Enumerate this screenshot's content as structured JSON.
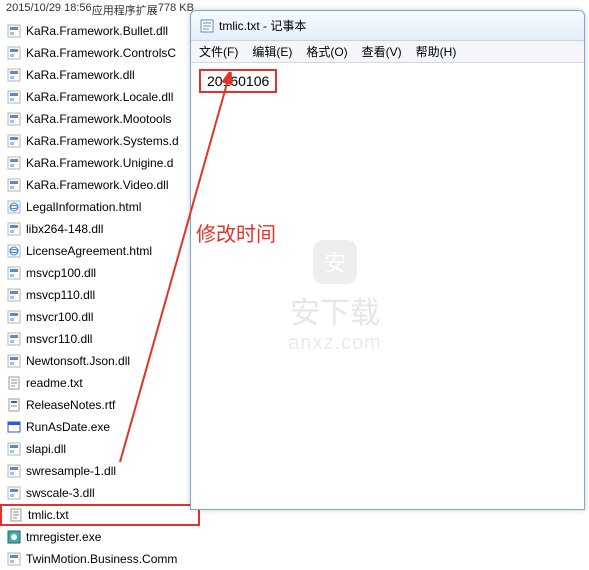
{
  "explorer": {
    "header": {
      "date": "2015/10/29 18:56",
      "type": "应用程序扩展",
      "size": "778 KB"
    },
    "files": [
      {
        "name": "KaRa.Framework.Bullet.dll",
        "icon": "dll"
      },
      {
        "name": "KaRa.Framework.ControlsC",
        "icon": "dll"
      },
      {
        "name": "KaRa.Framework.dll",
        "icon": "dll"
      },
      {
        "name": "KaRa.Framework.Locale.dll",
        "icon": "dll"
      },
      {
        "name": "KaRa.Framework.Mootools",
        "icon": "dll"
      },
      {
        "name": "KaRa.Framework.Systems.d",
        "icon": "dll"
      },
      {
        "name": "KaRa.Framework.Unigine.d",
        "icon": "dll"
      },
      {
        "name": "KaRa.Framework.Video.dll",
        "icon": "dll"
      },
      {
        "name": "LegalInformation.html",
        "icon": "html"
      },
      {
        "name": "libx264-148.dll",
        "icon": "dll"
      },
      {
        "name": "LicenseAgreement.html",
        "icon": "html"
      },
      {
        "name": "msvcp100.dll",
        "icon": "dll"
      },
      {
        "name": "msvcp110.dll",
        "icon": "dll"
      },
      {
        "name": "msvcr100.dll",
        "icon": "dll"
      },
      {
        "name": "msvcr110.dll",
        "icon": "dll"
      },
      {
        "name": "Newtonsoft.Json.dll",
        "icon": "dll"
      },
      {
        "name": "readme.txt",
        "icon": "txt"
      },
      {
        "name": "ReleaseNotes.rtf",
        "icon": "rtf"
      },
      {
        "name": "RunAsDate.exe",
        "icon": "exe"
      },
      {
        "name": "slapi.dll",
        "icon": "dll"
      },
      {
        "name": "swresample-1.dll",
        "icon": "dll"
      },
      {
        "name": "swscale-3.dll",
        "icon": "dll"
      },
      {
        "name": "tmlic.txt",
        "icon": "txt"
      },
      {
        "name": "tmregister.exe",
        "icon": "exe2"
      },
      {
        "name": "TwinMotion.Business.Comm",
        "icon": "dll"
      }
    ],
    "highlighted_index": 22
  },
  "notepad": {
    "title": "tmlic.txt - 记事本",
    "menu": {
      "file": "文件(F)",
      "edit": "编辑(E)",
      "format": "格式(O)",
      "view": "查看(V)",
      "help": "帮助(H)"
    },
    "content": "20160106"
  },
  "annotation": {
    "label": "修改时间"
  },
  "watermark": {
    "brand": "安下载",
    "domain": "anxz.com",
    "badge": "安"
  }
}
